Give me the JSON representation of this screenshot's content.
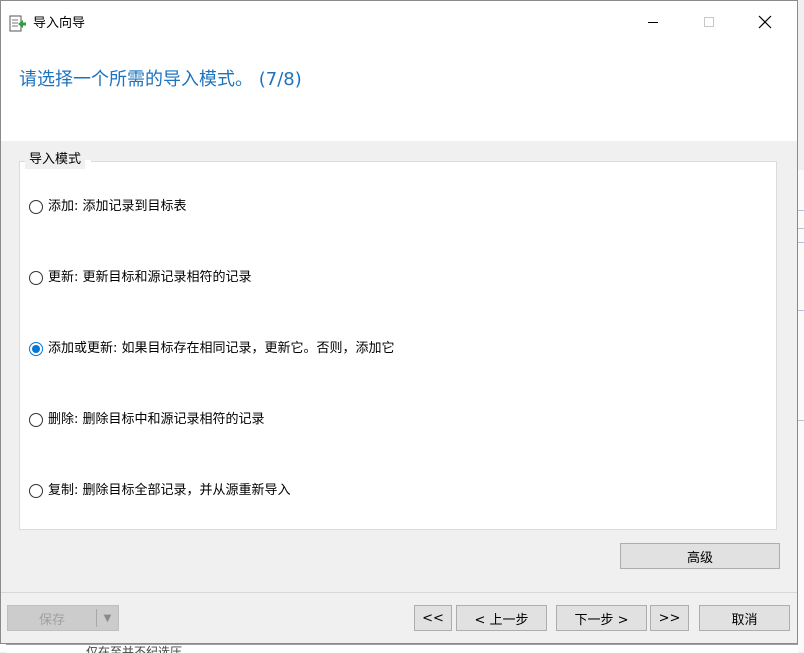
{
  "window": {
    "title": "导入向导",
    "icons": {
      "app": "import-wizard-icon",
      "minimize": "minimize-icon",
      "maximize": "maximize-icon",
      "close": "close-icon"
    }
  },
  "header": {
    "heading": "请选择一个所需的导入模式。 (7/8)"
  },
  "import_mode": {
    "legend": "导入模式",
    "selected": 2,
    "options": [
      {
        "label": "添加: 添加记录到目标表"
      },
      {
        "label": "更新: 更新目标和源记录相符的记录"
      },
      {
        "label": "添加或更新: 如果目标存在相同记录，更新它。否则，添加它"
      },
      {
        "label": "删除: 删除目标中和源记录相符的记录"
      },
      {
        "label": "复制: 删除目标全部记录，并从源重新导入"
      }
    ]
  },
  "advanced_button": "高级",
  "footer": {
    "save": "保存",
    "first": "<<",
    "prev": "< 上一步",
    "next": "下一步 >",
    "last": ">>",
    "cancel": "取消"
  },
  "background": {
    "bottom_text": "仅在至并不纪选压"
  },
  "colors": {
    "accent": "#1e73be",
    "radio_checked": "#0078d7"
  }
}
